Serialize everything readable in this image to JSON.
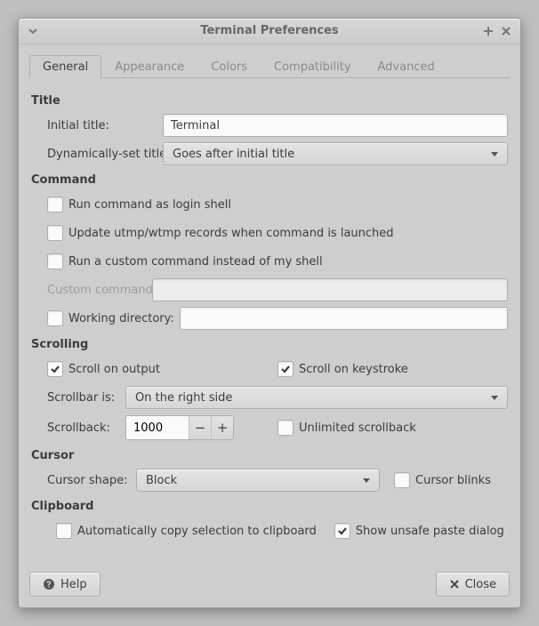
{
  "window": {
    "title": "Terminal Preferences"
  },
  "tabs": {
    "general": "General",
    "appearance": "Appearance",
    "colors": "Colors",
    "compatibility": "Compatibility",
    "advanced": "Advanced"
  },
  "section_titles": {
    "title": "Title",
    "command": "Command",
    "scrolling": "Scrolling",
    "cursor": "Cursor",
    "clipboard": "Clipboard"
  },
  "title": {
    "initial_label": "Initial title:",
    "initial_value": "Terminal",
    "dyn_label": "Dynamically-set title:",
    "dyn_value": "Goes after initial title"
  },
  "command": {
    "login_shell": "Run command as login shell",
    "update_records": "Update utmp/wtmp records when command is launched",
    "custom_instead": "Run a custom command instead of my shell",
    "custom_label": "Custom command:",
    "custom_value": "",
    "wd_label": "Working directory:",
    "wd_value": ""
  },
  "scrolling": {
    "on_output": "Scroll on output",
    "on_keystroke": "Scroll on keystroke",
    "scrollbar_label": "Scrollbar is:",
    "scrollbar_value": "On the right side",
    "scrollback_label": "Scrollback:",
    "scrollback_value": "1000",
    "unlimited": "Unlimited scrollback"
  },
  "cursor": {
    "shape_label": "Cursor shape:",
    "shape_value": "Block",
    "blinks": "Cursor blinks"
  },
  "clipboard": {
    "auto_copy": "Automatically copy selection to clipboard",
    "unsafe_paste": "Show unsafe paste dialog"
  },
  "footer": {
    "help": "Help",
    "close": "Close"
  }
}
